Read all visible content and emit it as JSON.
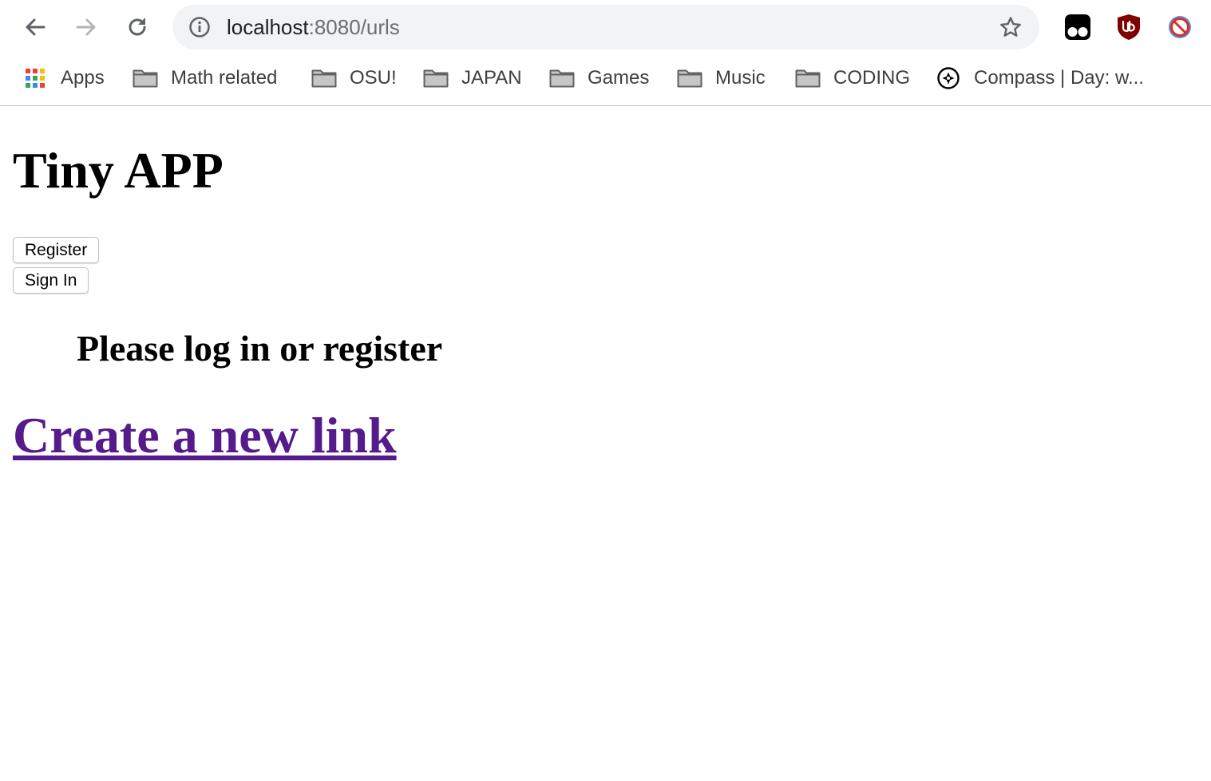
{
  "browser": {
    "url_host": "localhost",
    "url_path": ":8080/urls",
    "extensions": [
      "tampermonkey-icon",
      "ublock-origin-icon",
      "blocker-icon"
    ]
  },
  "bookmarks": [
    {
      "label": "Apps",
      "icon": "apps-grid-icon"
    },
    {
      "label": "Math related",
      "icon": "folder-icon"
    },
    {
      "label": "OSU!",
      "icon": "folder-icon"
    },
    {
      "label": "JAPAN",
      "icon": "folder-icon"
    },
    {
      "label": "Games",
      "icon": "folder-icon"
    },
    {
      "label": "Music",
      "icon": "folder-icon"
    },
    {
      "label": "CODING",
      "icon": "folder-icon"
    },
    {
      "label": "Compass | Day: w...",
      "icon": "compass-icon"
    }
  ],
  "page": {
    "title": "Tiny APP",
    "register_label": "Register",
    "signin_label": "Sign In",
    "notice": "Please log in or register",
    "create_link_label": "Create a new link"
  },
  "colors": {
    "visited_link": "#551a8b",
    "omnibox_bg": "#f1f3f4",
    "ublock_red": "#800000"
  }
}
